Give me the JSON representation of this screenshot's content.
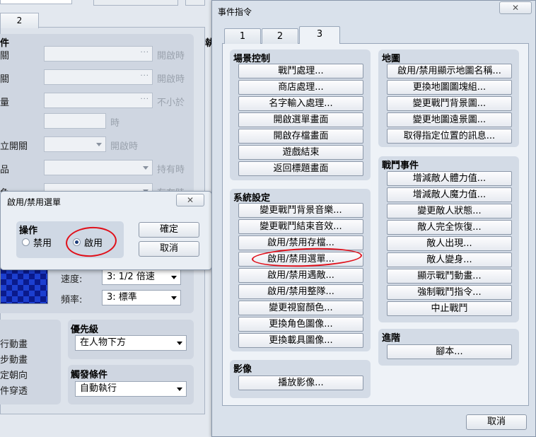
{
  "background": {
    "tab2_label": "2",
    "conditions_title": "件",
    "condition_rows": [
      {
        "label": "關",
        "hint": "開啟時"
      },
      {
        "label": "關",
        "hint": "開啟時"
      },
      {
        "label": "量",
        "hint": "不小於"
      },
      {
        "label": "",
        "hint": "時"
      },
      {
        "label": "立開關",
        "hint": "開啟時"
      },
      {
        "label": "品",
        "hint": "持有時"
      },
      {
        "label": "色",
        "hint": "存在時"
      }
    ],
    "speed_label": "速度:",
    "speed_value": "3: 1/2 倍速",
    "freq_label": "頻率:",
    "freq_value": "3: 標準",
    "options": [
      "行動畫",
      "步動畫",
      "定朝向",
      "件穿透"
    ],
    "priority_title": "優先級",
    "priority_value": "在人物下方",
    "trigger_title": "觸發條件",
    "trigger_value": "自動執行",
    "side_title": "執"
  },
  "small_dialog": {
    "title": "啟用/禁用選單",
    "close_icon": "✕",
    "group_title": "操作",
    "radio_disable": "禁用",
    "radio_enable": "啟用",
    "selected": "啟用",
    "ok": "確定",
    "cancel": "取消"
  },
  "event_window": {
    "title": "事件指令",
    "close_icon": "✕",
    "tabs": [
      "1",
      "2",
      "3"
    ],
    "active_tab": "3",
    "scene_title": "場景控制",
    "scene_items": [
      "戰鬥處理...",
      "商店處理...",
      "名字輸入處理...",
      "開啟選單畫面",
      "開啟存檔畫面",
      "遊戲結束",
      "返回標題畫面"
    ],
    "system_title": "系統設定",
    "system_items": [
      "變更戰鬥背景音樂...",
      "變更戰鬥結束音效...",
      "啟用/禁用存檔...",
      "啟用/禁用選單...",
      "啟用/禁用遇敵...",
      "啟用/禁用整隊...",
      "變更視窗顏色...",
      "更換角色圖像...",
      "更換載具圖像..."
    ],
    "image_title": "影像",
    "image_items": [
      "播放影像..."
    ],
    "map_title": "地圖",
    "map_items": [
      "啟用/禁用顯示地圖名稱...",
      "更換地圖圖塊組...",
      "變更戰鬥背景圖...",
      "變更地圖遠景圖...",
      "取得指定位置的訊息..."
    ],
    "battle_title": "戰鬥事件",
    "battle_items": [
      "增減敵人體力值...",
      "增減敵人魔力值...",
      "變更敵人狀態...",
      "敵人完全恢復...",
      "敵人出現...",
      "敵人變身...",
      "顯示戰鬥動畫...",
      "強制戰鬥指令...",
      "中止戰鬥"
    ],
    "advanced_title": "進階",
    "advanced_items": [
      "腳本..."
    ],
    "cancel": "取消"
  }
}
